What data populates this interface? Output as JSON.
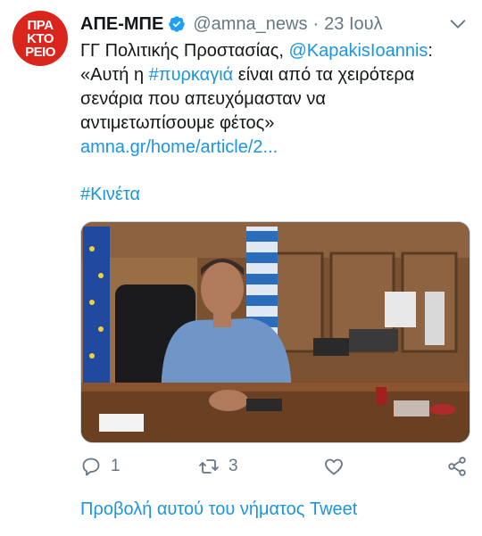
{
  "avatar": {
    "lines": [
      "ΠΡΑ",
      "ΚΤΟ",
      "ΡΕΙΟ"
    ],
    "color": "#d9251c"
  },
  "header": {
    "name": "ΑΠΕ-ΜΠΕ",
    "handle": "@amna_news",
    "separator": "·",
    "time": "23 Ιουλ",
    "verified_icon": "verified-badge-icon",
    "menu_icon": "chevron-down-icon"
  },
  "tweet": {
    "line1_prefix": "ΓΓ Πολιτικής Προστασίας, ",
    "line1_mention": "@KapakisIoannis",
    "line1_suffix": ":",
    "line2_prefix": "«Αυτή η ",
    "line2_hashtag": "#πυρκαγιά",
    "line2_suffix": " είναι από τα χειρότερα",
    "line3": "σενάρια που απευχόμασταν να",
    "line4": "αντιμετωπίσουμε φέτος»",
    "link": "amna.gr/home/article/2...",
    "hashtag": "#Κινέτα"
  },
  "actions": {
    "reply_icon": "reply-icon",
    "reply_count": "1",
    "retweet_icon": "retweet-icon",
    "retweet_count": "3",
    "like_icon": "heart-icon",
    "share_icon": "share-icon"
  },
  "thread_link": "Προβολή αυτού του νήματος Tweet",
  "colors": {
    "link": "#1b95e0",
    "muted": "#657786",
    "text": "#14171a"
  }
}
